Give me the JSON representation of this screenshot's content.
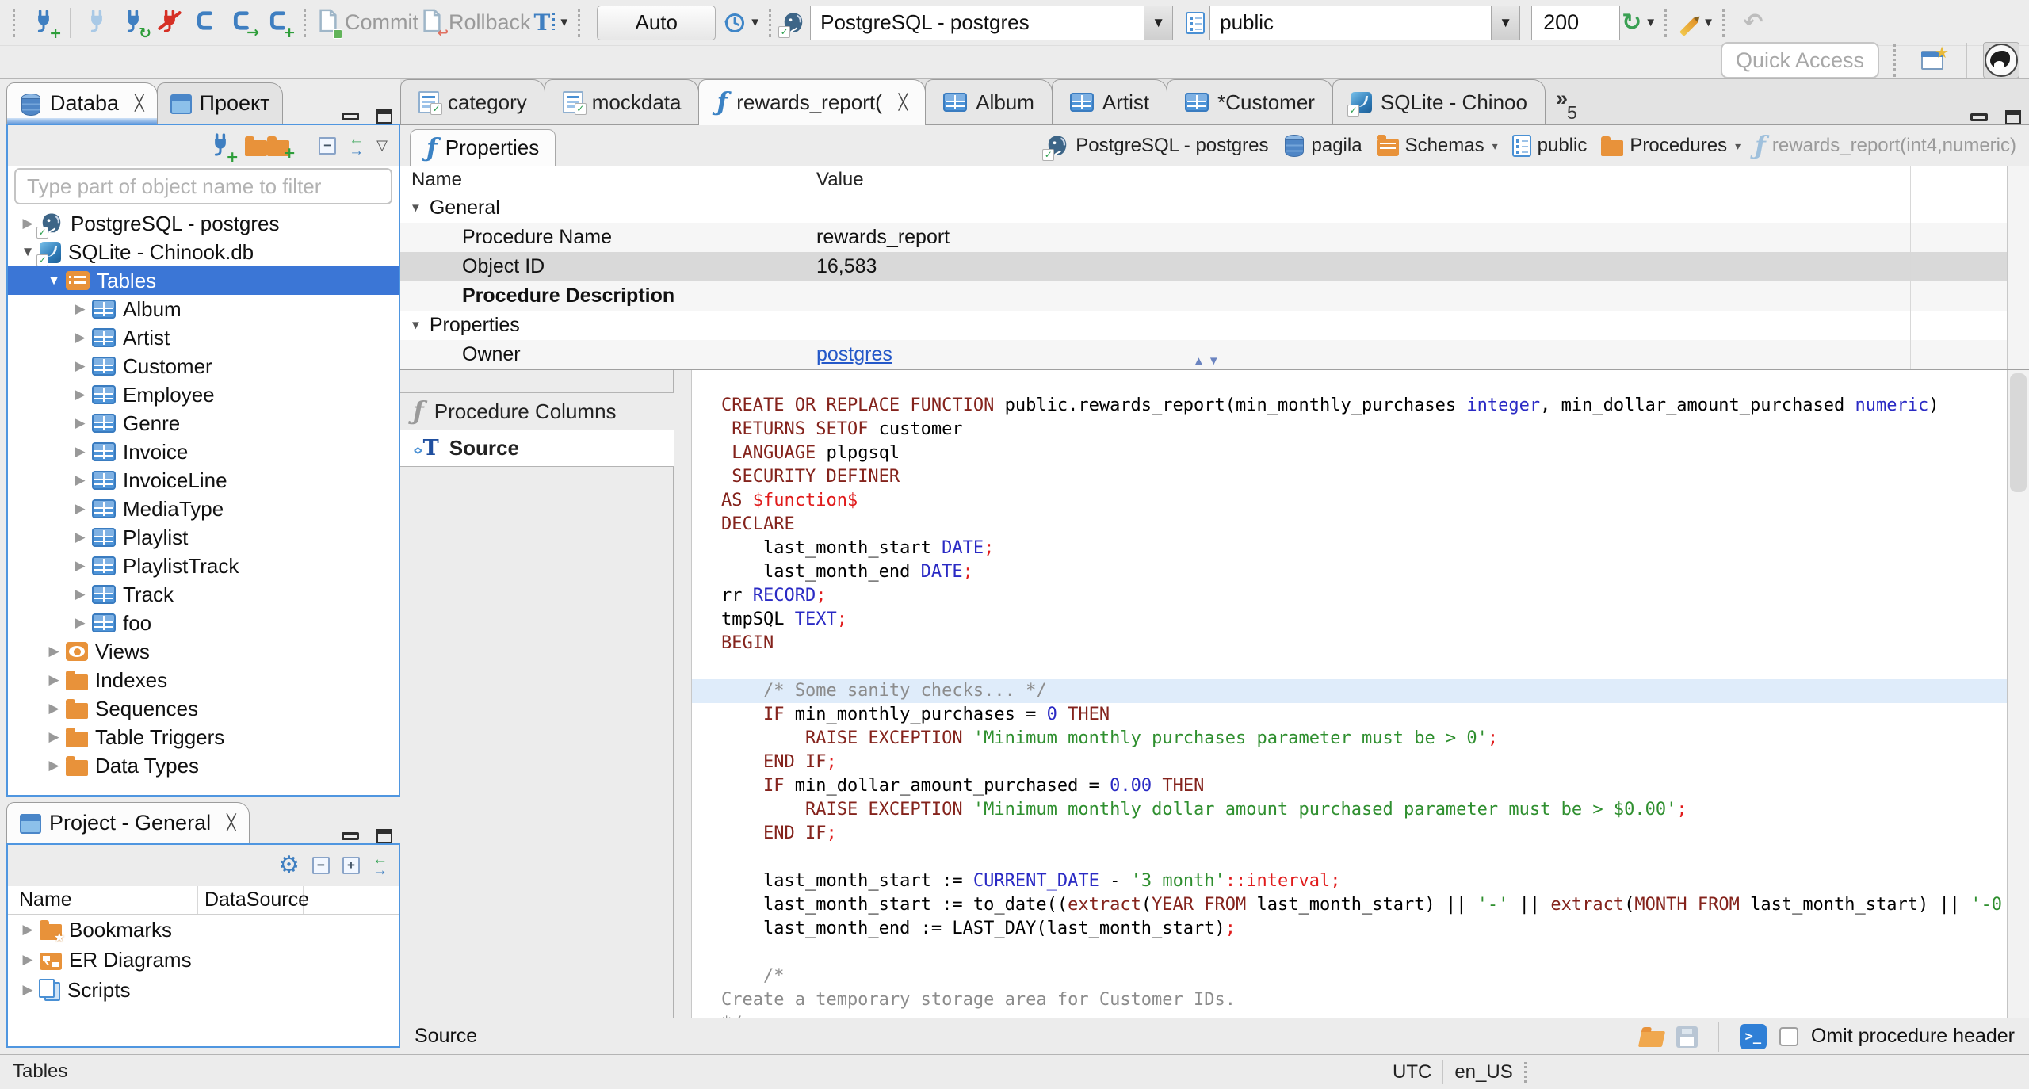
{
  "toolbar": {
    "commit_label": "Commit",
    "rollback_label": "Rollback",
    "auto_label": "Auto",
    "connection_value": "PostgreSQL - postgres",
    "schema_value": "public",
    "fetch_size_value": "200",
    "quick_access_placeholder": "Quick Access"
  },
  "sidebar": {
    "tabs": [
      {
        "label": "Databa",
        "icon": "db-stack",
        "active": true,
        "closable": true
      },
      {
        "label": "Проект",
        "icon": "window"
      }
    ],
    "filter_placeholder": "Type part of object name to filter",
    "tree": [
      {
        "label": "PostgreSQL - postgres",
        "icon": "postgres",
        "level": 0,
        "state": "collapsed"
      },
      {
        "label": "SQLite - Chinook.db",
        "icon": "sqlite",
        "level": 0,
        "state": "expanded"
      },
      {
        "label": "Tables",
        "icon": "tables-folder",
        "level": 1,
        "state": "expanded",
        "selected": true
      },
      {
        "label": "Album",
        "icon": "table",
        "level": 2,
        "state": "collapsed"
      },
      {
        "label": "Artist",
        "icon": "table",
        "level": 2,
        "state": "collapsed"
      },
      {
        "label": "Customer",
        "icon": "table",
        "level": 2,
        "state": "collapsed"
      },
      {
        "label": "Employee",
        "icon": "table",
        "level": 2,
        "state": "collapsed"
      },
      {
        "label": "Genre",
        "icon": "table",
        "level": 2,
        "state": "collapsed"
      },
      {
        "label": "Invoice",
        "icon": "table",
        "level": 2,
        "state": "collapsed"
      },
      {
        "label": "InvoiceLine",
        "icon": "table",
        "level": 2,
        "state": "collapsed"
      },
      {
        "label": "MediaType",
        "icon": "table",
        "level": 2,
        "state": "collapsed"
      },
      {
        "label": "Playlist",
        "icon": "table",
        "level": 2,
        "state": "collapsed"
      },
      {
        "label": "PlaylistTrack",
        "icon": "table",
        "level": 2,
        "state": "collapsed"
      },
      {
        "label": "Track",
        "icon": "table",
        "level": 2,
        "state": "collapsed"
      },
      {
        "label": "foo",
        "icon": "table",
        "level": 2,
        "state": "collapsed"
      },
      {
        "label": "Views",
        "icon": "views",
        "level": 1,
        "state": "collapsed"
      },
      {
        "label": "Indexes",
        "icon": "folder",
        "level": 1,
        "state": "collapsed"
      },
      {
        "label": "Sequences",
        "icon": "folder",
        "level": 1,
        "state": "collapsed"
      },
      {
        "label": "Table Triggers",
        "icon": "folder",
        "level": 1,
        "state": "collapsed"
      },
      {
        "label": "Data Types",
        "icon": "folder",
        "level": 1,
        "state": "collapsed"
      }
    ]
  },
  "project": {
    "tab_label": "Project - General",
    "columns": [
      "Name",
      "DataSource"
    ],
    "items": [
      {
        "label": "Bookmarks",
        "icon": "bookmarks"
      },
      {
        "label": "ER Diagrams",
        "icon": "erd"
      },
      {
        "label": "Scripts",
        "icon": "scripts"
      }
    ]
  },
  "editor": {
    "tabs": [
      {
        "label": "category",
        "icon": "script"
      },
      {
        "label": "mockdata",
        "icon": "script"
      },
      {
        "label": "rewards_report(",
        "icon": "fn",
        "active": true,
        "closable": true
      },
      {
        "label": "Album",
        "icon": "table"
      },
      {
        "label": "Artist",
        "icon": "table"
      },
      {
        "label": "*Customer",
        "icon": "table"
      },
      {
        "label": "SQLite - Chinoo",
        "icon": "sqlite"
      }
    ],
    "overflow_count": "5",
    "properties_tab_label": "Properties",
    "breadcrumb": [
      {
        "label": "PostgreSQL - postgres",
        "icon": "postgres"
      },
      {
        "label": "pagila",
        "icon": "db-stack"
      },
      {
        "label": "Schemas",
        "icon": "schemas-folder",
        "dropdown": true
      },
      {
        "label": "public",
        "icon": "schema-doc"
      },
      {
        "label": "Procedures",
        "icon": "folder",
        "dropdown": true
      },
      {
        "label": "rewards_report(int4,numeric)",
        "icon": "fn-pale",
        "muted": true
      }
    ],
    "grid": {
      "columns": [
        "Name",
        "Value"
      ],
      "rows": [
        {
          "name": "General",
          "group": true,
          "value": ""
        },
        {
          "name": "Procedure Name",
          "value": "rewards_report"
        },
        {
          "name": "Object ID",
          "value": "16,583",
          "selected": true
        },
        {
          "name": "Procedure Description",
          "bold": true,
          "value": ""
        },
        {
          "name": "Properties",
          "group": true,
          "value": ""
        },
        {
          "name": "Owner",
          "value": "postgres",
          "link": true
        }
      ]
    },
    "subtabs": [
      {
        "label": "Procedure Columns",
        "icon": "fn-gray"
      },
      {
        "label": "Source",
        "icon": "source",
        "active": true
      }
    ],
    "footer": {
      "label": "Source",
      "omit_label": "Omit procedure header",
      "omit_checked": false
    }
  },
  "status": {
    "left": "Tables",
    "timezone": "UTC",
    "locale": "en_US"
  },
  "code": {
    "lines": [
      {
        "seg": [
          [
            "k",
            "CREATE OR REPLACE FUNCTION"
          ],
          [
            "p",
            " public.rewards_report(min_monthly_purchases "
          ],
          [
            "t",
            "integer"
          ],
          [
            "p",
            ", min_dollar_amount_purchased "
          ],
          [
            "t",
            "numeric"
          ],
          [
            "p",
            ")"
          ]
        ]
      },
      {
        "seg": [
          [
            "p",
            " "
          ],
          [
            "k",
            "RETURNS SETOF"
          ],
          [
            "p",
            " customer"
          ]
        ]
      },
      {
        "seg": [
          [
            "p",
            " "
          ],
          [
            "k",
            "LANGUAGE"
          ],
          [
            "p",
            " plpgsql"
          ]
        ]
      },
      {
        "seg": [
          [
            "p",
            " "
          ],
          [
            "k",
            "SECURITY DEFINER"
          ]
        ]
      },
      {
        "seg": [
          [
            "k",
            "AS"
          ],
          [
            "p",
            " "
          ],
          [
            "r",
            "$function$"
          ]
        ]
      },
      {
        "seg": [
          [
            "k",
            "DECLARE"
          ]
        ]
      },
      {
        "seg": [
          [
            "p",
            "    last_month_start "
          ],
          [
            "t",
            "DATE"
          ],
          [
            "r",
            ";"
          ]
        ]
      },
      {
        "seg": [
          [
            "p",
            "    last_month_end "
          ],
          [
            "t",
            "DATE"
          ],
          [
            "r",
            ";"
          ]
        ]
      },
      {
        "seg": [
          [
            "p",
            "rr "
          ],
          [
            "t",
            "RECORD"
          ],
          [
            "r",
            ";"
          ]
        ]
      },
      {
        "seg": [
          [
            "p",
            "tmpSQL "
          ],
          [
            "t",
            "TEXT"
          ],
          [
            "r",
            ";"
          ]
        ]
      },
      {
        "seg": [
          [
            "k",
            "BEGIN"
          ]
        ]
      },
      {
        "seg": []
      },
      {
        "hl": true,
        "seg": [
          [
            "c",
            "    /* Some sanity checks... */"
          ]
        ]
      },
      {
        "seg": [
          [
            "p",
            "    "
          ],
          [
            "k",
            "IF"
          ],
          [
            "p",
            " min_monthly_purchases = "
          ],
          [
            "n",
            "0"
          ],
          [
            "p",
            " "
          ],
          [
            "k",
            "THEN"
          ]
        ]
      },
      {
        "seg": [
          [
            "p",
            "        "
          ],
          [
            "k",
            "RAISE EXCEPTION"
          ],
          [
            "p",
            " "
          ],
          [
            "s",
            "'Minimum monthly purchases parameter must be > 0'"
          ],
          [
            "r",
            ";"
          ]
        ]
      },
      {
        "seg": [
          [
            "p",
            "    "
          ],
          [
            "k",
            "END IF"
          ],
          [
            "r",
            ";"
          ]
        ]
      },
      {
        "seg": [
          [
            "p",
            "    "
          ],
          [
            "k",
            "IF"
          ],
          [
            "p",
            " min_dollar_amount_purchased = "
          ],
          [
            "n",
            "0.00"
          ],
          [
            "p",
            " "
          ],
          [
            "k",
            "THEN"
          ]
        ]
      },
      {
        "seg": [
          [
            "p",
            "        "
          ],
          [
            "k",
            "RAISE EXCEPTION"
          ],
          [
            "p",
            " "
          ],
          [
            "s",
            "'Minimum monthly dollar amount purchased parameter must be > $0.00'"
          ],
          [
            "r",
            ";"
          ]
        ]
      },
      {
        "seg": [
          [
            "p",
            "    "
          ],
          [
            "k",
            "END IF"
          ],
          [
            "r",
            ";"
          ]
        ]
      },
      {
        "seg": []
      },
      {
        "seg": [
          [
            "p",
            "    last_month_start := "
          ],
          [
            "t",
            "CURRENT_DATE"
          ],
          [
            "p",
            " - "
          ],
          [
            "s",
            "'3 month'"
          ],
          [
            "r",
            "::interval;"
          ]
        ]
      },
      {
        "seg": [
          [
            "p",
            "    last_month_start := to_date(("
          ],
          [
            "k",
            "extract"
          ],
          [
            "p",
            "("
          ],
          [
            "k",
            "YEAR FROM"
          ],
          [
            "p",
            " last_month_start) || "
          ],
          [
            "s",
            "'-'"
          ],
          [
            "p",
            " || "
          ],
          [
            "k",
            "extract"
          ],
          [
            "p",
            "("
          ],
          [
            "k",
            "MONTH FROM"
          ],
          [
            "p",
            " last_month_start) || "
          ],
          [
            "s",
            "'-0"
          ]
        ]
      },
      {
        "seg": [
          [
            "p",
            "    last_month_end := LAST_DAY(last_month_start)"
          ],
          [
            "r",
            ";"
          ]
        ]
      },
      {
        "seg": []
      },
      {
        "seg": [
          [
            "c",
            "    /*"
          ]
        ]
      },
      {
        "seg": [
          [
            "c",
            "Create a temporary storage area for Customer IDs."
          ]
        ]
      },
      {
        "seg": [
          [
            "c",
            "*/"
          ]
        ]
      }
    ]
  }
}
